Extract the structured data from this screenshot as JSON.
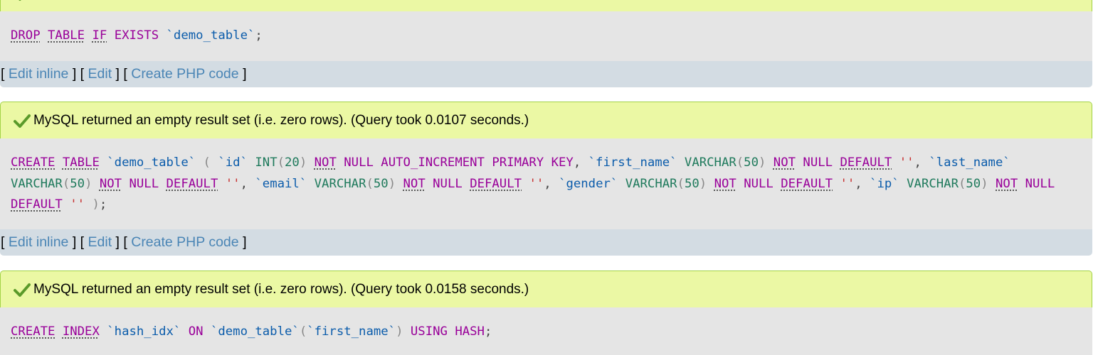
{
  "blocks": [
    {
      "message": "",
      "sql_tokens": [
        {
          "t": "DROP",
          "c": "kw-under"
        },
        {
          "t": " "
        },
        {
          "t": "TABLE",
          "c": "kw-under"
        },
        {
          "t": " "
        },
        {
          "t": "IF",
          "c": "kw-under"
        },
        {
          "t": " "
        },
        {
          "t": "EXISTS",
          "c": "kw"
        },
        {
          "t": " "
        },
        {
          "t": "`demo_table`",
          "c": "bt"
        },
        {
          "t": ";",
          "c": "punct"
        }
      ],
      "tools": {
        "edit_inline": "Edit inline",
        "edit": "Edit",
        "create_php": "Create PHP code"
      }
    },
    {
      "message": "MySQL returned an empty result set (i.e. zero rows). (Query took 0.0107 seconds.)",
      "sql_tokens": [
        {
          "t": "CREATE",
          "c": "kw-under"
        },
        {
          "t": " "
        },
        {
          "t": "TABLE",
          "c": "kw-under"
        },
        {
          "t": " "
        },
        {
          "t": "`demo_table`",
          "c": "bt"
        },
        {
          "t": " "
        },
        {
          "t": "(",
          "c": "paren"
        },
        {
          "t": " "
        },
        {
          "t": "`id`",
          "c": "bt"
        },
        {
          "t": " "
        },
        {
          "t": "INT",
          "c": "type"
        },
        {
          "t": "(",
          "c": "paren"
        },
        {
          "t": "20",
          "c": "type"
        },
        {
          "t": ")",
          "c": "paren"
        },
        {
          "t": " "
        },
        {
          "t": "NOT",
          "c": "kw-under"
        },
        {
          "t": " "
        },
        {
          "t": "NULL",
          "c": "kw"
        },
        {
          "t": " "
        },
        {
          "t": "AUTO_INCREMENT",
          "c": "kw"
        },
        {
          "t": " "
        },
        {
          "t": "PRIMARY",
          "c": "kw"
        },
        {
          "t": " "
        },
        {
          "t": "KEY",
          "c": "kw"
        },
        {
          "t": ",",
          "c": "punct"
        },
        {
          "t": " "
        },
        {
          "t": "`first_name`",
          "c": "bt"
        },
        {
          "t": " "
        },
        {
          "t": "VARCHAR",
          "c": "type"
        },
        {
          "t": "(",
          "c": "paren"
        },
        {
          "t": "50",
          "c": "type"
        },
        {
          "t": ")",
          "c": "paren"
        },
        {
          "t": " "
        },
        {
          "t": "NOT",
          "c": "kw-under"
        },
        {
          "t": " "
        },
        {
          "t": "NULL",
          "c": "kw"
        },
        {
          "t": " "
        },
        {
          "t": "DEFAULT",
          "c": "kw-under"
        },
        {
          "t": " "
        },
        {
          "t": "''",
          "c": "str"
        },
        {
          "t": ",",
          "c": "punct"
        },
        {
          "t": " "
        },
        {
          "t": "`last_name`",
          "c": "bt"
        },
        {
          "t": " "
        },
        {
          "t": "VARCHAR",
          "c": "type"
        },
        {
          "t": "(",
          "c": "paren"
        },
        {
          "t": "50",
          "c": "type"
        },
        {
          "t": ")",
          "c": "paren"
        },
        {
          "t": " "
        },
        {
          "t": "NOT",
          "c": "kw-under"
        },
        {
          "t": " "
        },
        {
          "t": "NULL",
          "c": "kw"
        },
        {
          "t": " "
        },
        {
          "t": "DEFAULT",
          "c": "kw-under"
        },
        {
          "t": " "
        },
        {
          "t": "''",
          "c": "str"
        },
        {
          "t": ",",
          "c": "punct"
        },
        {
          "t": " "
        },
        {
          "t": "`email`",
          "c": "bt"
        },
        {
          "t": " "
        },
        {
          "t": "VARCHAR",
          "c": "type"
        },
        {
          "t": "(",
          "c": "paren"
        },
        {
          "t": "50",
          "c": "type"
        },
        {
          "t": ")",
          "c": "paren"
        },
        {
          "t": " "
        },
        {
          "t": "NOT",
          "c": "kw-under"
        },
        {
          "t": " "
        },
        {
          "t": "NULL",
          "c": "kw"
        },
        {
          "t": " "
        },
        {
          "t": "DEFAULT",
          "c": "kw-under"
        },
        {
          "t": " "
        },
        {
          "t": "''",
          "c": "str"
        },
        {
          "t": ",",
          "c": "punct"
        },
        {
          "t": " "
        },
        {
          "t": "`gender`",
          "c": "bt"
        },
        {
          "t": " "
        },
        {
          "t": "VARCHAR",
          "c": "type"
        },
        {
          "t": "(",
          "c": "paren"
        },
        {
          "t": "50",
          "c": "type"
        },
        {
          "t": ")",
          "c": "paren"
        },
        {
          "t": " "
        },
        {
          "t": "NOT",
          "c": "kw-under"
        },
        {
          "t": " "
        },
        {
          "t": "NULL",
          "c": "kw"
        },
        {
          "t": " "
        },
        {
          "t": "DEFAULT",
          "c": "kw-under"
        },
        {
          "t": " "
        },
        {
          "t": "''",
          "c": "str"
        },
        {
          "t": ",",
          "c": "punct"
        },
        {
          "t": " "
        },
        {
          "t": "`ip`",
          "c": "bt"
        },
        {
          "t": " "
        },
        {
          "t": "VARCHAR",
          "c": "type"
        },
        {
          "t": "(",
          "c": "paren"
        },
        {
          "t": "50",
          "c": "type"
        },
        {
          "t": ")",
          "c": "paren"
        },
        {
          "t": " "
        },
        {
          "t": "NOT",
          "c": "kw-under"
        },
        {
          "t": " "
        },
        {
          "t": "NULL",
          "c": "kw"
        },
        {
          "t": " "
        },
        {
          "t": "DEFAULT",
          "c": "kw-under"
        },
        {
          "t": " "
        },
        {
          "t": "''",
          "c": "str"
        },
        {
          "t": " "
        },
        {
          "t": ")",
          "c": "paren"
        },
        {
          "t": ";",
          "c": "punct"
        }
      ],
      "tools": {
        "edit_inline": "Edit inline",
        "edit": "Edit",
        "create_php": "Create PHP code"
      }
    },
    {
      "message": "MySQL returned an empty result set (i.e. zero rows). (Query took 0.0158 seconds.)",
      "sql_tokens": [
        {
          "t": "CREATE",
          "c": "kw-under"
        },
        {
          "t": " "
        },
        {
          "t": "INDEX",
          "c": "kw-under"
        },
        {
          "t": " "
        },
        {
          "t": "`hash_idx`",
          "c": "bt"
        },
        {
          "t": " "
        },
        {
          "t": "ON",
          "c": "kw"
        },
        {
          "t": " "
        },
        {
          "t": "`demo_table`",
          "c": "bt"
        },
        {
          "t": "(",
          "c": "paren"
        },
        {
          "t": "`first_name`",
          "c": "bt"
        },
        {
          "t": ")",
          "c": "paren"
        },
        {
          "t": " "
        },
        {
          "t": "USING",
          "c": "kw"
        },
        {
          "t": " "
        },
        {
          "t": "HASH",
          "c": "kw"
        },
        {
          "t": ";",
          "c": "punct"
        }
      ],
      "tools": {
        "edit_inline": "Edit inline",
        "edit": "Edit",
        "create_php": "Create PHP code"
      }
    }
  ],
  "tool_separators": {
    "open": "[",
    "close": "]"
  },
  "icons": {
    "success": "check-icon"
  },
  "colors": {
    "success_bg": "#ebf8a4",
    "success_border": "#a2d246",
    "sql_bg": "#e5e5e5",
    "tools_bg": "#d3dce3",
    "link": "#4a85b5"
  }
}
